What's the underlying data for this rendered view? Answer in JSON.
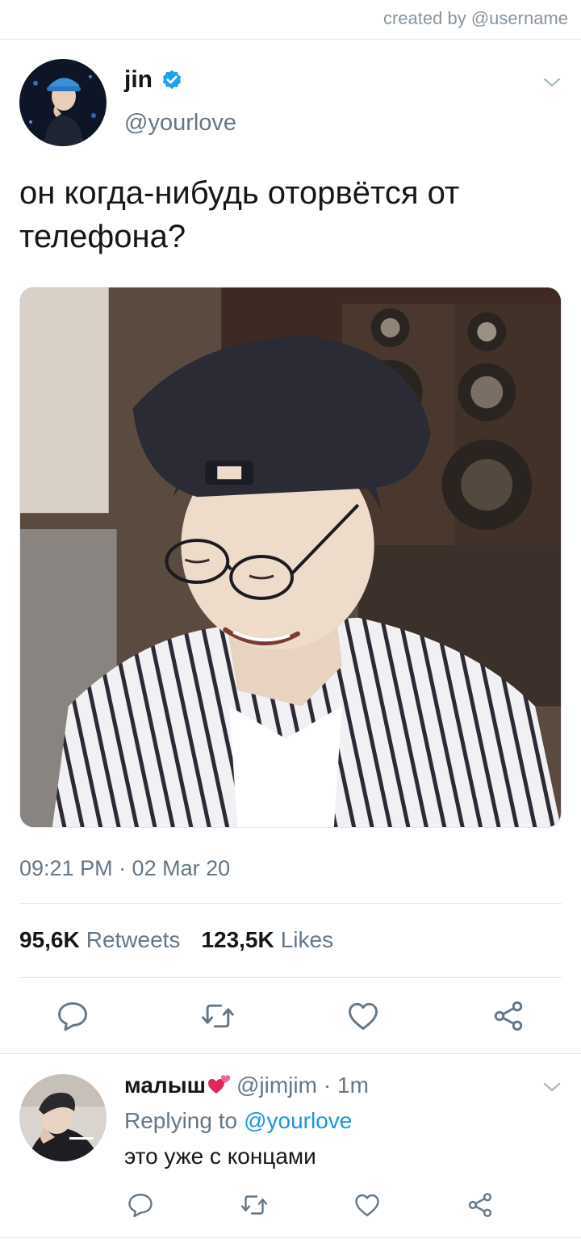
{
  "credit": "created by @username",
  "tweet": {
    "author_name": "jin",
    "author_handle": "@yourlove",
    "text": "он когда-нибудь оторвётся от телефона?",
    "timestamp": "09:21 PM · 02 Mar 20",
    "retweets_count": "95,6K",
    "retweets_label": "Retweets",
    "likes_count": "123,5K",
    "likes_label": "Likes"
  },
  "reply": {
    "author_name": "малыш",
    "author_handle": "@jimjim",
    "time": "· 1m",
    "replying_label": "Replying to",
    "replying_mention": "@yourlove",
    "text": "это уже с концами"
  },
  "icons": {
    "verified": "verified-badge-icon",
    "chevron": "chevron-down-icon",
    "reply": "comment-icon",
    "retweet": "retweet-icon",
    "like": "heart-icon",
    "share": "share-icon",
    "emoji": "two-hearts-emoji"
  },
  "colors": {
    "accent": "#1b95e0",
    "secondary_text": "#657786",
    "divider": "#e1e8ed",
    "verified": "#1da1f2"
  }
}
